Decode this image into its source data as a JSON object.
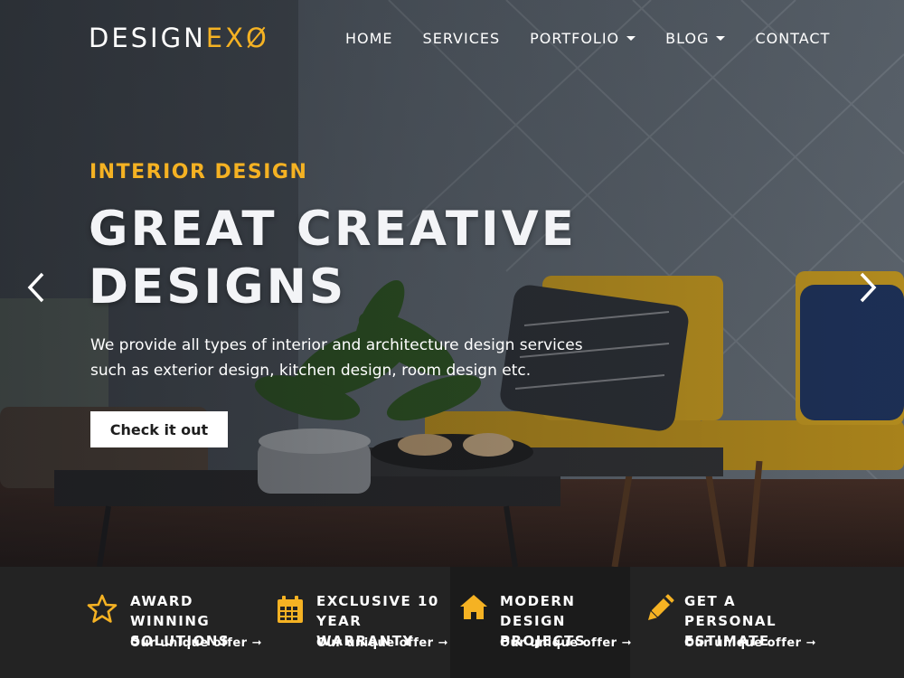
{
  "brand": {
    "name_main": "DESIGN",
    "name_accent": "EXØ",
    "accent_color": "#f5b223"
  },
  "nav": {
    "items": [
      {
        "label": "HOME",
        "dropdown": false
      },
      {
        "label": "SERVICES",
        "dropdown": false
      },
      {
        "label": "PORTFOLIO",
        "dropdown": true
      },
      {
        "label": "BLOG",
        "dropdown": true
      },
      {
        "label": "CONTACT",
        "dropdown": false
      }
    ]
  },
  "hero": {
    "eyebrow": "INTERIOR DESIGN",
    "headline": "GREAT CREATIVE DESIGNS",
    "description": "We provide all types of interior and architecture design services such as exterior design, kitchen design, room design etc.",
    "cta_label": "Check it out",
    "prev_icon": "chevron-left-icon",
    "next_icon": "chevron-right-icon"
  },
  "features": [
    {
      "icon": "star-icon",
      "title": "AWARD WINNING\nSOLUTIONS",
      "link": "Our unique offer ➞"
    },
    {
      "icon": "calendar-icon",
      "title": "EXCLUSIVE 10\nYEAR WARRANTY",
      "link": "Our unique offer ➞"
    },
    {
      "icon": "home-icon",
      "title": "MODERN DESIGN\nPROJECTS",
      "link": "Our unique offer ➞"
    },
    {
      "icon": "pencil-icon",
      "title": "GET A PERSONAL\nESTIMATE",
      "link": "Our unique offer ➞"
    }
  ],
  "colors": {
    "accent": "#f5b223",
    "feature_bar": "#232323",
    "feature_highlight": "#1b1b1b"
  }
}
